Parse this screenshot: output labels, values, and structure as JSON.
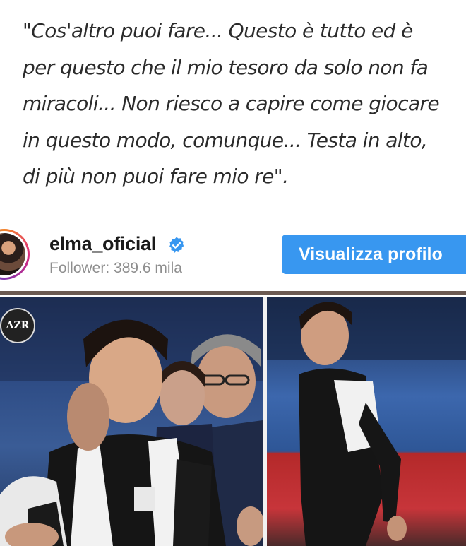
{
  "quote": {
    "lines": [
      "\"Cos'altro puoi fare... Questo è tutto ed è",
      "per questo che il mio tesoro da solo non fa",
      "miracoli... Non riesco a capire come giocare",
      "in questo modo, comunque... Testa in alto,",
      "di più non puoi fare mio re\"."
    ]
  },
  "profile": {
    "username": "elma_oficial",
    "followers": "Follower: 389.6 mila",
    "view_button_label": "Visualizza profilo",
    "verified_icon": "verified-badge-icon",
    "accent_color": "#3897f0"
  },
  "post": {
    "watermark_text": "AZR"
  }
}
